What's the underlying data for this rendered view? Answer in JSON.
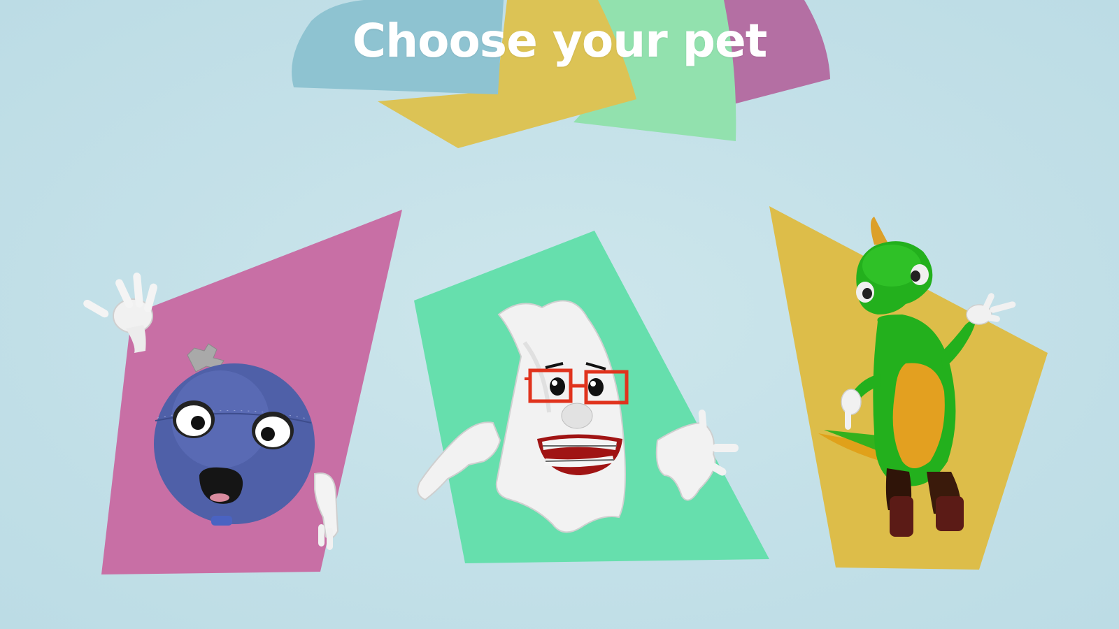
{
  "title": "Choose your pet",
  "colors": {
    "background": "#c4e1e9",
    "banner_blue": "#8ec3d1",
    "banner_yellow": "#dcc355",
    "banner_green": "#92e1ae",
    "banner_purple": "#b46fa3",
    "card_pink": "#c86fa5",
    "card_green": "#66dfad",
    "card_yellow": "#ddbd49"
  },
  "pets": [
    {
      "id": "robot-ball",
      "icon": "blue-robot-ball-pet-icon"
    },
    {
      "id": "ghost",
      "icon": "ghost-with-glasses-pet-icon"
    },
    {
      "id": "dinosaur",
      "icon": "green-dinosaur-pet-icon"
    }
  ]
}
